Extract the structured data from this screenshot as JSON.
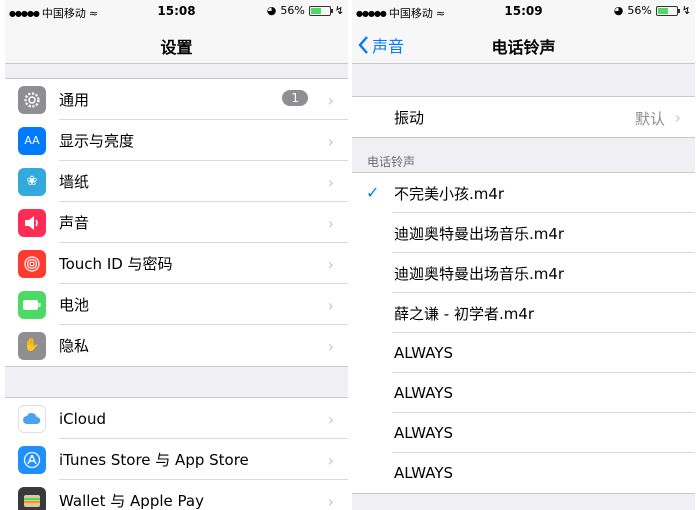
{
  "left": {
    "status": {
      "carrier": "中国移动",
      "time": "15:08",
      "battery": "56%"
    },
    "title": "设置",
    "group1": [
      {
        "label": "通用",
        "icon": "gear-icon",
        "color": "#8e8e93",
        "badge": "1"
      },
      {
        "label": "显示与亮度",
        "icon": "text-size-icon",
        "color": "#007aff"
      },
      {
        "label": "墙纸",
        "icon": "flower-icon",
        "color": "#34aadc"
      },
      {
        "label": "声音",
        "icon": "speaker-icon",
        "color": "#ff2d55"
      },
      {
        "label": "Touch ID 与密码",
        "icon": "fingerprint-icon",
        "color": "#ff3b30"
      },
      {
        "label": "电池",
        "icon": "battery-icon",
        "color": "#4cd964"
      },
      {
        "label": "隐私",
        "icon": "hand-icon",
        "color": "#8e8e93"
      }
    ],
    "group2": [
      {
        "label": "iCloud",
        "icon": "cloud-icon",
        "color": "#ffffff"
      },
      {
        "label": "iTunes Store 与 App Store",
        "icon": "app-store-icon",
        "color": "#1e90ff"
      },
      {
        "label": "Wallet 与 Apple Pay",
        "icon": "wallet-icon",
        "color": "#3a3a3c"
      }
    ]
  },
  "right": {
    "status": {
      "carrier": "中国移动",
      "time": "15:09",
      "battery": "56%"
    },
    "back_label": "声音",
    "title": "电话铃声",
    "vibration": {
      "label": "振动",
      "value": "默认"
    },
    "section_header": "电话铃声",
    "ringtones": [
      {
        "label": "不完美小孩.m4r",
        "selected": true
      },
      {
        "label": "迪迦奥特曼出场音乐.m4r",
        "selected": false
      },
      {
        "label": "迪迦奥特曼出场音乐.m4r",
        "selected": false
      },
      {
        "label": "薛之谦 - 初学者.m4r",
        "selected": false
      },
      {
        "label": "ALWAYS",
        "selected": false
      },
      {
        "label": "ALWAYS",
        "selected": false
      },
      {
        "label": "ALWAYS",
        "selected": false
      },
      {
        "label": "ALWAYS",
        "selected": false
      }
    ]
  }
}
